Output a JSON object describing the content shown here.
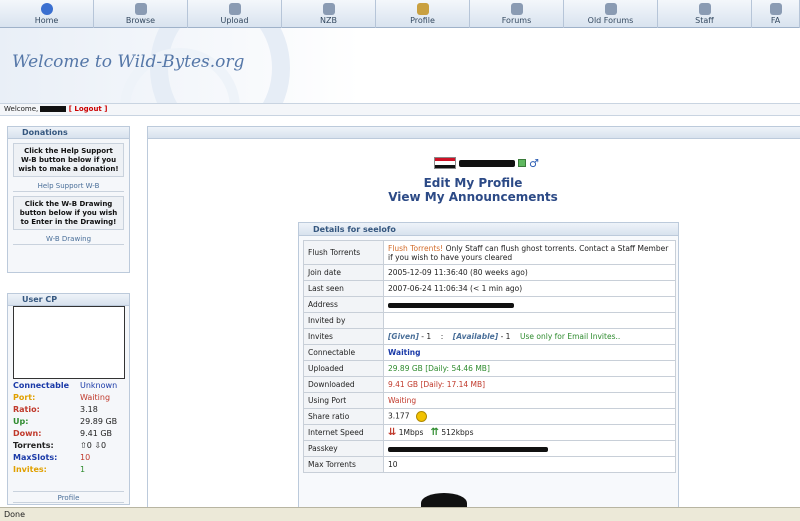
{
  "nav": [
    {
      "label": "Home",
      "icon": "home-icon",
      "color": "#3a6fd0"
    },
    {
      "label": "Browse",
      "icon": "browse-icon",
      "color": "#8a9bb3"
    },
    {
      "label": "Upload",
      "icon": "upload-icon",
      "color": "#8a9bb3"
    },
    {
      "label": "NZB",
      "icon": "nzb-icon",
      "color": "#8a9bb3"
    },
    {
      "label": "Profile",
      "icon": "profile-icon",
      "color": "#c9a040"
    },
    {
      "label": "Forums",
      "icon": "forums-icon",
      "color": "#8a9bb3"
    },
    {
      "label": "Old Forums",
      "icon": "old-forums-icon",
      "color": "#8a9bb3"
    },
    {
      "label": "Staff",
      "icon": "staff-icon",
      "color": "#8a9bb3"
    },
    {
      "label": "FA",
      "icon": "faq-icon",
      "color": "#8a9bb3"
    }
  ],
  "banner": {
    "title": "Welcome to Wild-Bytes.org"
  },
  "welcome": {
    "prefix": "Welcome,",
    "logout": "[ Logout ]"
  },
  "donations": {
    "title": "Donations",
    "promo1": "Click the Help Support W-B button below if you wish to make a donation!",
    "link1": "Help Support W-B",
    "promo2": "Click the W-B Drawing button below if you wish to Enter in the Drawing!",
    "link2": "W-B Drawing"
  },
  "usercp": {
    "title": "User CP",
    "stats": [
      {
        "k": "Connectable",
        "v": "Unknown",
        "kc": "#1a3aa8",
        "vc": "#1a3aa8"
      },
      {
        "k": "Port:",
        "v": "Waiting",
        "kc": "#e0a000",
        "vc": "#c0392b"
      },
      {
        "k": "Ratio:",
        "v": "3.18",
        "kc": "#c0392b",
        "vc": "#222222"
      },
      {
        "k": "Up:",
        "v": "29.89 GB",
        "kc": "#2e8b2e",
        "vc": "#222222"
      },
      {
        "k": "Down:",
        "v": "9.41 GB",
        "kc": "#c0392b",
        "vc": "#222222"
      },
      {
        "k": "Torrents:",
        "v": "⇧0 ⇩0",
        "kc": "#222222",
        "vc": "#222222"
      },
      {
        "k": "MaxSlots:",
        "v": "10",
        "kc": "#1a3aa8",
        "vc": "#c0392b"
      },
      {
        "k": "Invites:",
        "v": "1",
        "kc": "#e0a000",
        "vc": "#2e8b2e"
      }
    ],
    "link": "Profile"
  },
  "profile": {
    "edit": "Edit My Profile",
    "view_ann": "View My Announcements",
    "details_title": "Details for seelofo",
    "rows": [
      {
        "k": "Flush Torrents",
        "v_red": "Flush Torrents!",
        "v": " Only Staff can flush ghost torrents. Contact a Staff Member if you wish to have yours cleared"
      },
      {
        "k": "Join date",
        "v": "2005-12-09 11:36:40 (80 weeks ago)"
      },
      {
        "k": "Last seen",
        "v": "2007-06-24 11:06:34 (< 1 min ago)"
      },
      {
        "k": "Address",
        "v": ""
      },
      {
        "k": "Invited by",
        "v": ""
      },
      {
        "k": "Invites",
        "given": "[Given]",
        "given_val": " - 1",
        "avail": "[Available]",
        "avail_val": " - 1",
        "note": "Use only for Email Invites.."
      },
      {
        "k": "Connectable",
        "v": "Waiting"
      },
      {
        "k": "Uploaded",
        "v": "29.89 GB",
        "extra": "[Daily: 54.46 MB]"
      },
      {
        "k": "Downloaded",
        "v": "9.41 GB",
        "extra": "[Daily: 17.14 MB]"
      },
      {
        "k": "Using Port",
        "v": "Waiting"
      },
      {
        "k": "Share ratio",
        "v": "3.177"
      },
      {
        "k": "Internet Speed",
        "down": "1Mbps",
        "up": "512kbps"
      },
      {
        "k": "Passkey",
        "v": ""
      },
      {
        "k": "Max Torrents",
        "v": "10"
      }
    ]
  },
  "status": {
    "text": "Done"
  }
}
